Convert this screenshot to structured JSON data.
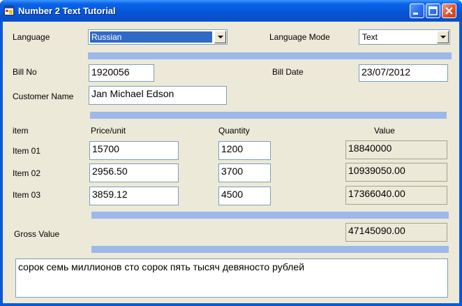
{
  "window": {
    "title": "Number 2 Text Tutorial"
  },
  "header": {
    "language_label": "Language",
    "language_value": "Russian",
    "language_mode_label": "Language Mode",
    "language_mode_value": "Text"
  },
  "bill": {
    "bill_no_label": "Bill No",
    "bill_no_value": "1920056",
    "bill_date_label": "Bill Date",
    "bill_date_value": "23/07/2012",
    "customer_label": "Customer Name",
    "customer_value": "Jan Michael Edson"
  },
  "items": {
    "col_item": "item",
    "col_price": "Price/unit",
    "col_qty": "Quantity",
    "col_value": "Value",
    "rows": [
      {
        "name": "Item 01",
        "price": "15700",
        "qty": "1200",
        "value": "18840000"
      },
      {
        "name": "Item 02",
        "price": "2956.50",
        "qty": "3700",
        "value": "10939050.00"
      },
      {
        "name": "Item 03",
        "price": "3859.12",
        "qty": "4500",
        "value": "17366040.00"
      }
    ]
  },
  "gross": {
    "label": "Gross Value",
    "value": "47145090.00"
  },
  "words": "сорок семь миллионов сто сорок пять тысяч девяносто рублей",
  "colors": {
    "title_bar": "#0a5ee0",
    "separator": "#9db9eb",
    "form_bg": "#ece9d8",
    "selection": "#316ac5"
  }
}
